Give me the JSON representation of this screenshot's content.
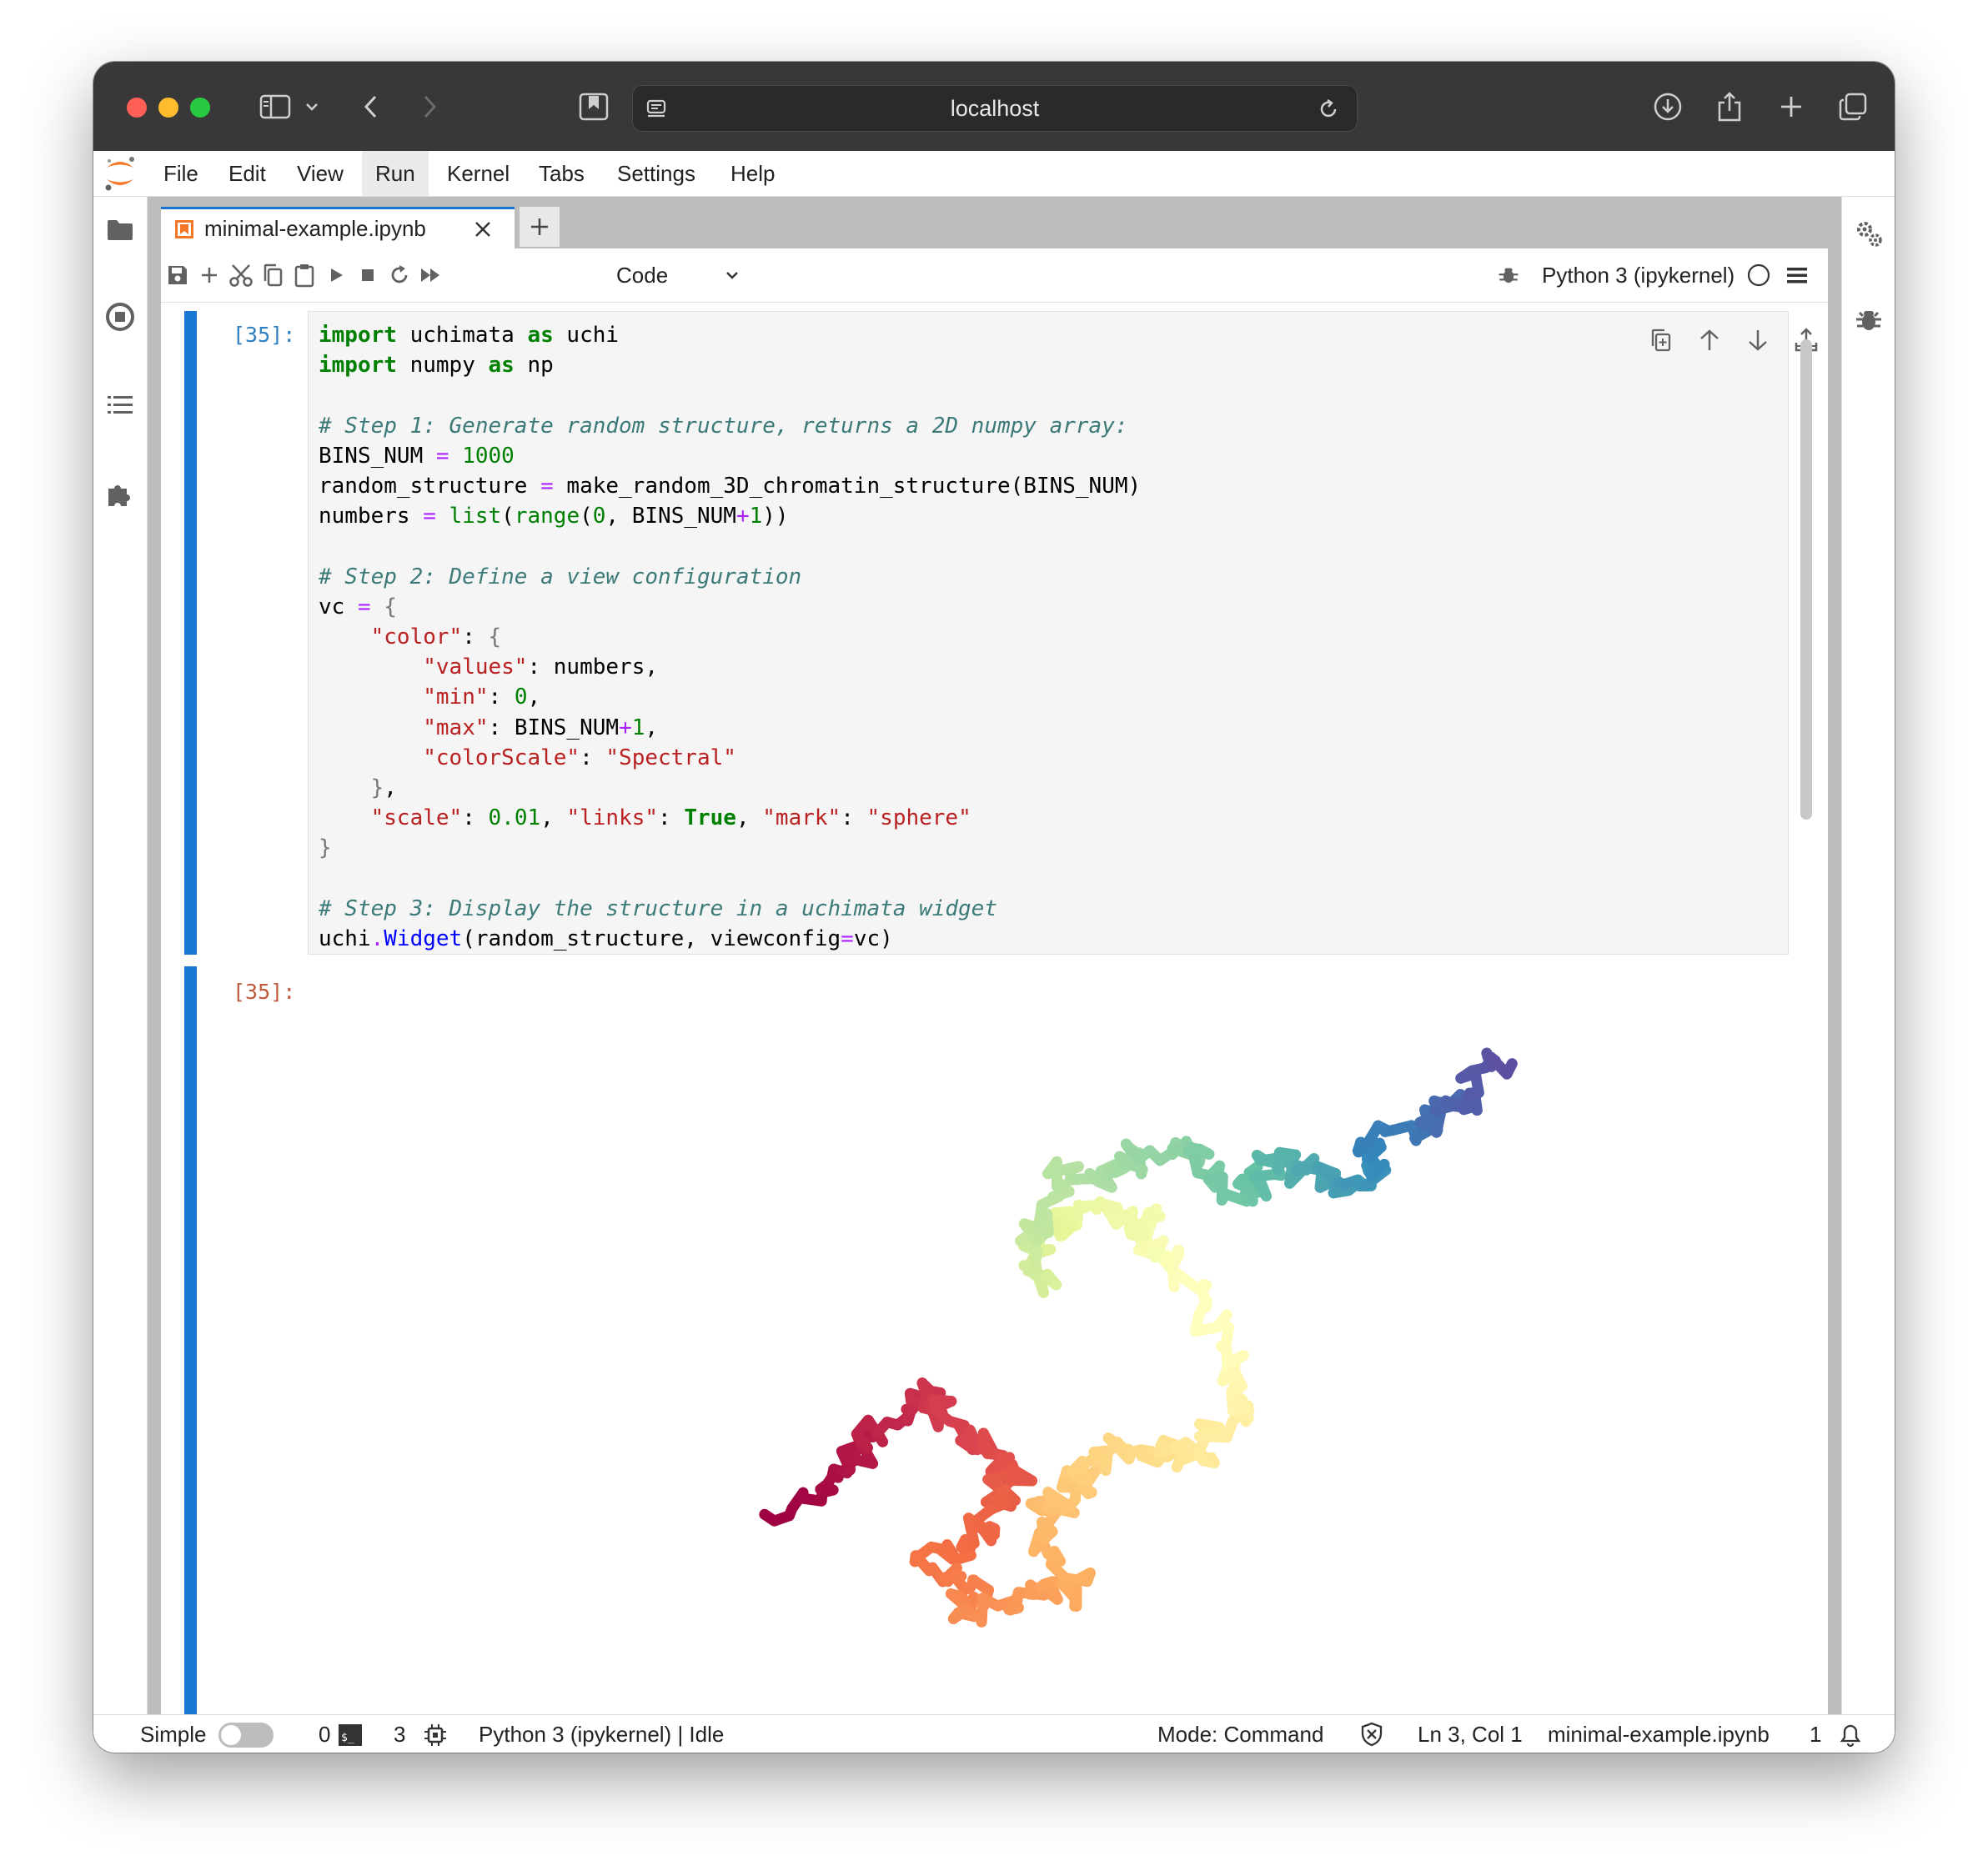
{
  "browser": {
    "url": "localhost",
    "icons": [
      "sidebar-icon",
      "chevron-down-icon",
      "back-icon",
      "forward-icon",
      "bookmarks-icon",
      "site-settings-icon",
      "reload-icon",
      "download-icon",
      "share-icon",
      "new-tab-icon",
      "tabs-overview-icon"
    ]
  },
  "menubar": {
    "items": [
      "File",
      "Edit",
      "View",
      "Run",
      "Kernel",
      "Tabs",
      "Settings",
      "Help"
    ],
    "active": "Run"
  },
  "tab": {
    "filename": "minimal-example.ipynb"
  },
  "toolbar": {
    "cell_type": "Code",
    "kernel": "Python 3 (ipykernel)"
  },
  "cells": {
    "input_prompt": "[35]:",
    "output_prompt": "[35]:"
  },
  "code_lines": [
    [
      [
        "kw",
        "import"
      ],
      [
        "t",
        " uchimata "
      ],
      [
        "kw",
        "as"
      ],
      [
        "t",
        " uchi"
      ]
    ],
    [
      [
        "kw",
        "import"
      ],
      [
        "t",
        " numpy "
      ],
      [
        "kw",
        "as"
      ],
      [
        "t",
        " np"
      ]
    ],
    [
      [
        "t",
        ""
      ]
    ],
    [
      [
        "cm",
        "# Step 1: Generate random structure, returns a 2D numpy array:"
      ]
    ],
    [
      [
        "t",
        "BINS_NUM "
      ],
      [
        "op",
        "="
      ],
      [
        "t",
        " "
      ],
      [
        "nm",
        "1000"
      ]
    ],
    [
      [
        "t",
        "random_structure "
      ],
      [
        "op",
        "="
      ],
      [
        "t",
        " make_random_3D_chromatin_structure(BINS_NUM)"
      ]
    ],
    [
      [
        "t",
        "numbers "
      ],
      [
        "op",
        "="
      ],
      [
        "t",
        " "
      ],
      [
        "bi",
        "list"
      ],
      [
        "t",
        "("
      ],
      [
        "bi",
        "range"
      ],
      [
        "t",
        "("
      ],
      [
        "nm",
        "0"
      ],
      [
        "t",
        ", BINS_NUM"
      ],
      [
        "op",
        "+"
      ],
      [
        "nm",
        "1"
      ],
      [
        "t",
        "))"
      ]
    ],
    [
      [
        "t",
        ""
      ]
    ],
    [
      [
        "cm",
        "# Step 2: Define a view configuration"
      ]
    ],
    [
      [
        "t",
        "vc "
      ],
      [
        "op",
        "="
      ],
      [
        "t",
        " "
      ],
      [
        "br",
        "{"
      ]
    ],
    [
      [
        "t",
        "    "
      ],
      [
        "st",
        "\"color\""
      ],
      [
        "t",
        ": "
      ],
      [
        "br",
        "{"
      ]
    ],
    [
      [
        "t",
        "        "
      ],
      [
        "st",
        "\"values\""
      ],
      [
        "t",
        ": numbers,"
      ]
    ],
    [
      [
        "t",
        "        "
      ],
      [
        "st",
        "\"min\""
      ],
      [
        "t",
        ": "
      ],
      [
        "nm",
        "0"
      ],
      [
        "t",
        ","
      ]
    ],
    [
      [
        "t",
        "        "
      ],
      [
        "st",
        "\"max\""
      ],
      [
        "t",
        ": BINS_NUM"
      ],
      [
        "op",
        "+"
      ],
      [
        "nm",
        "1"
      ],
      [
        "t",
        ","
      ]
    ],
    [
      [
        "t",
        "        "
      ],
      [
        "st",
        "\"colorScale\""
      ],
      [
        "t",
        ": "
      ],
      [
        "st",
        "\"Spectral\""
      ]
    ],
    [
      [
        "t",
        "    "
      ],
      [
        "br",
        "}"
      ],
      [
        "t",
        ","
      ]
    ],
    [
      [
        "t",
        "    "
      ],
      [
        "st",
        "\"scale\""
      ],
      [
        "t",
        ": "
      ],
      [
        "nm",
        "0.01"
      ],
      [
        "t",
        ", "
      ],
      [
        "st",
        "\"links\""
      ],
      [
        "t",
        ": "
      ],
      [
        "kw",
        "True"
      ],
      [
        "t",
        ", "
      ],
      [
        "st",
        "\"mark\""
      ],
      [
        "t",
        ": "
      ],
      [
        "st",
        "\"sphere\""
      ]
    ],
    [
      [
        "br",
        "}"
      ]
    ],
    [
      [
        "t",
        ""
      ]
    ],
    [
      [
        "cm",
        "# Step 3: Display the structure in a uchimata widget"
      ]
    ],
    [
      [
        "t",
        "uchi"
      ],
      [
        "op",
        "."
      ],
      [
        "fn",
        "Widget"
      ],
      [
        "t",
        "(random_structure, viewconfig"
      ],
      [
        "op",
        "="
      ],
      [
        "t",
        "vc)"
      ]
    ]
  ],
  "statusbar": {
    "mode_label": "Simple",
    "count_a": "0",
    "count_b": "3",
    "kernel_status": "Python 3 (ipykernel) | Idle",
    "mode": "Mode: Command",
    "cursor": "Ln 3, Col 1",
    "filename": "minimal-example.ipynb",
    "notifications": "1"
  },
  "colors": {
    "accent": "#1976d2",
    "chrome": "#383838",
    "spectral": [
      "#9e0142",
      "#d53e4f",
      "#f46d43",
      "#fdae61",
      "#fee08b",
      "#ffffbf",
      "#e6f598",
      "#abdda4",
      "#66c2a5",
      "#3288bd",
      "#5e4fa2"
    ]
  }
}
